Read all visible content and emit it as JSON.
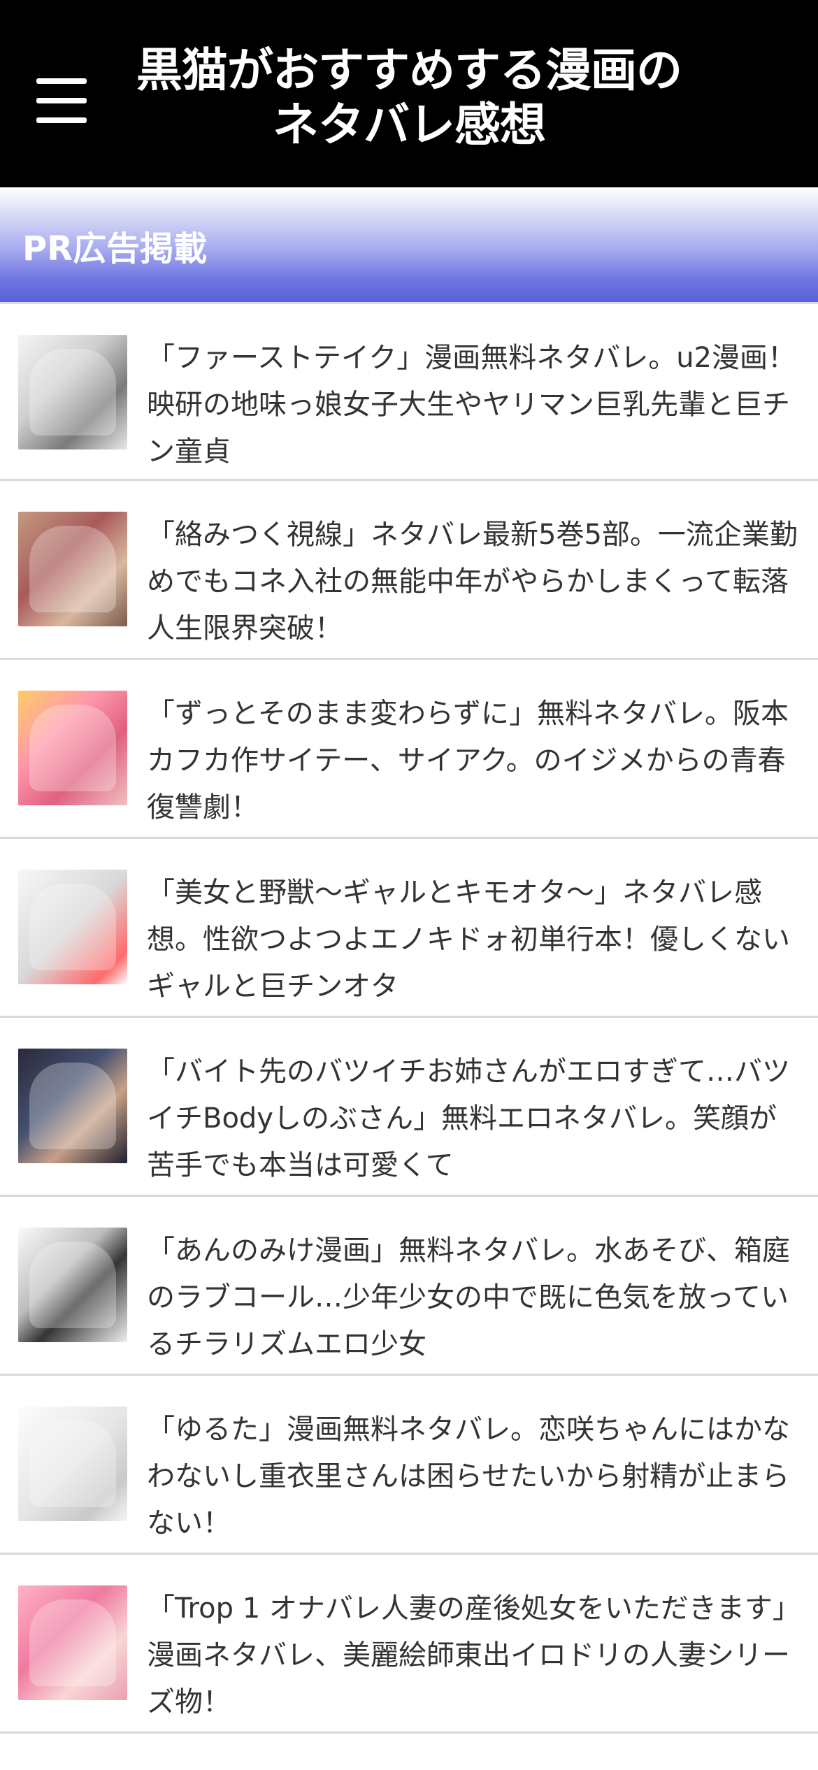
{
  "header": {
    "menu_icon": "hamburger-menu-icon",
    "title": "黒猫がおすすめする漫画のネタバレ感想"
  },
  "pr_section": {
    "title": "PR広告掲載"
  },
  "articles": [
    {
      "title": "「ファーストテイク」漫画無料ネタバレ。u2漫画！映研の地味っ娘女子大生やヤリマン巨乳先輩と巨チン童貞"
    },
    {
      "title": "「絡みつく視線」ネタバレ最新5巻5部。一流企業勤めでもコネ入社の無能中年がやらかしまくって転落人生限界突破！"
    },
    {
      "title": "「ずっとそのまま変わらずに」無料ネタバレ。阪本カフカ作サイテー、サイアク。のイジメからの青春復讐劇！"
    },
    {
      "title": "「美女と野獣～ギャルとキモオタ～」ネタバレ感想。性欲つよつよエノキドォ初単行本！優しくないギャルと巨チンオタ"
    },
    {
      "title": "「バイト先のバツイチお姉さんがエロすぎて…バツイチBodyしのぶさん」無料エロネタバレ。笑顔が苦手でも本当は可愛くて"
    },
    {
      "title": "「あんのみけ漫画」無料ネタバレ。水あそび、箱庭のラブコール…少年少女の中で既に色気を放っているチラリズムエロ少女"
    },
    {
      "title": "「ゆるた」漫画無料ネタバレ。恋咲ちゃんにはかなわないし重衣里さんは困らせたいから射精が止まらない！"
    },
    {
      "title": "「Trop 1 オナバレ人妻の産後処女をいただきます」漫画ネタバレ、美麗絵師東出イロドリの人妻シリーズ物！"
    }
  ],
  "colors": {
    "header_bg": "#000000",
    "header_text": "#ffffff",
    "pr_gradient_end": "#5a61da",
    "article_text": "#333333",
    "divider": "#d9d9d9"
  }
}
